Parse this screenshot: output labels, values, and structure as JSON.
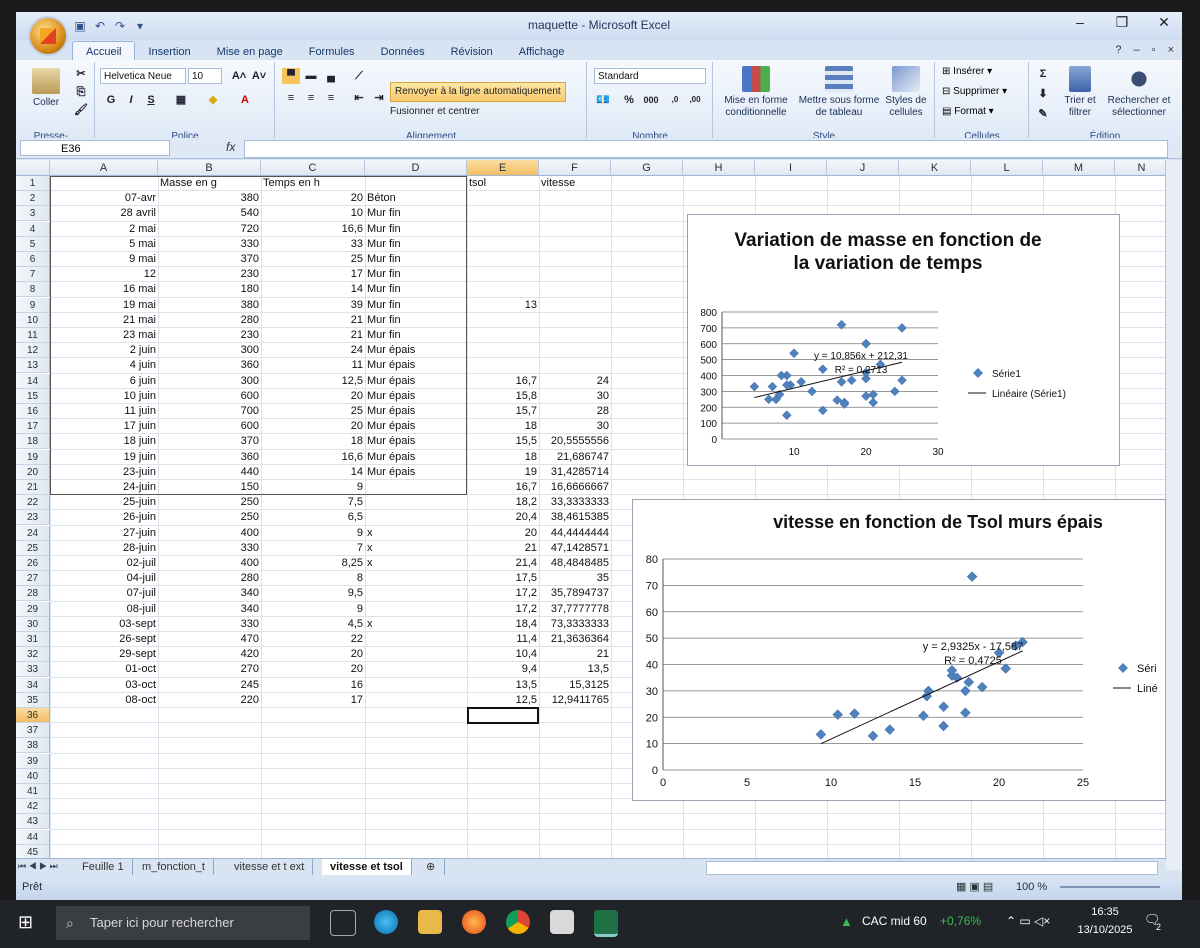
{
  "window": {
    "title": "maquette - Microsoft Excel"
  },
  "ribbon": {
    "tabs": [
      "Accueil",
      "Insertion",
      "Mise en page",
      "Formules",
      "Données",
      "Révision",
      "Affichage"
    ],
    "paste_label": "Coller",
    "font_name": "Helvetica Neue",
    "font_size": "10",
    "wrap_text": "Renvoyer à la ligne automatiquement",
    "merge_center": "Fusionner et centrer",
    "number_format": "Standard",
    "cond_format": "Mise en forme conditionnelle",
    "format_table": "Mettre sous forme de tableau",
    "cell_styles": "Styles de cellules",
    "insert": "Insérer",
    "delete": "Supprimer",
    "format": "Format",
    "sort_filter": "Trier et filtrer",
    "find_select": "Rechercher et sélectionner",
    "groups": {
      "clipboard": "Presse-...",
      "font": "Police",
      "alignment": "Alignement",
      "number": "Nombre",
      "style": "Style",
      "cells": "Cellules",
      "edit": "Édition"
    }
  },
  "formula_bar": {
    "name_box": "E36",
    "fx": "fx"
  },
  "columns": [
    "A",
    "B",
    "C",
    "D",
    "E",
    "F",
    "G",
    "H",
    "I",
    "J",
    "K",
    "L",
    "M",
    "N"
  ],
  "rows": [
    [
      "",
      "Masse en g",
      "Temps en h",
      "",
      "tsol",
      "vitesse"
    ],
    [
      "07-avr",
      "380",
      "20",
      "Béton",
      "",
      ""
    ],
    [
      "28 avril",
      "540",
      "10",
      "Mur fin",
      "",
      ""
    ],
    [
      "2 mai",
      "720",
      "16,6",
      "Mur fin",
      "",
      ""
    ],
    [
      "5 mai",
      "330",
      "33",
      "Mur fin",
      "",
      ""
    ],
    [
      "9 mai",
      "370",
      "25",
      "Mur fin",
      "",
      ""
    ],
    [
      "12",
      "230",
      "17",
      "Mur fin",
      "",
      ""
    ],
    [
      "16 mai",
      "180",
      "14",
      "Mur fin",
      "",
      ""
    ],
    [
      "19 mai",
      "380",
      "39",
      "Mur fin",
      "13",
      ""
    ],
    [
      "21 mai",
      "280",
      "21",
      "Mur fin",
      "",
      ""
    ],
    [
      "23 mai",
      "230",
      "21",
      "Mur fin",
      "",
      ""
    ],
    [
      "2 juin",
      "300",
      "24",
      "Mur épais",
      "",
      ""
    ],
    [
      "4 juin",
      "360",
      "11",
      "Mur épais",
      "",
      ""
    ],
    [
      "6 juin",
      "300",
      "12,5",
      "Mur épais",
      "16,7",
      "24"
    ],
    [
      "10 juin",
      "600",
      "20",
      "Mur épais",
      "15,8",
      "30"
    ],
    [
      "11 juin",
      "700",
      "25",
      "Mur épais",
      "15,7",
      "28"
    ],
    [
      "17 juin",
      "600",
      "20",
      "Mur épais",
      "18",
      "30"
    ],
    [
      "18 juin",
      "370",
      "18",
      "Mur épais",
      "15,5",
      "20,5555556"
    ],
    [
      "19 juin",
      "360",
      "16,6",
      "Mur épais",
      "18",
      "21,686747"
    ],
    [
      "23-juin",
      "440",
      "14",
      "Mur épais",
      "19",
      "31,4285714"
    ],
    [
      "24-juin",
      "150",
      "9",
      "",
      "16,7",
      "16,6666667"
    ],
    [
      "25-juin",
      "250",
      "7,5",
      "",
      "18,2",
      "33,3333333"
    ],
    [
      "26-juin",
      "250",
      "6,5",
      "",
      "20,4",
      "38,4615385"
    ],
    [
      "27-juin",
      "400",
      "9",
      "x",
      "20",
      "44,4444444"
    ],
    [
      "28-juin",
      "330",
      "7",
      "x",
      "21",
      "47,1428571"
    ],
    [
      "02-juil",
      "400",
      "8,25",
      "x",
      "21,4",
      "48,4848485"
    ],
    [
      "04-juil",
      "280",
      "8",
      "",
      "17,5",
      "35"
    ],
    [
      "07-juil",
      "340",
      "9,5",
      "",
      "17,2",
      "35,7894737"
    ],
    [
      "08-juil",
      "340",
      "9",
      "",
      "17,2",
      "37,7777778"
    ],
    [
      "03-sept",
      "330",
      "4,5",
      "x",
      "18,4",
      "73,3333333"
    ],
    [
      "26-sept",
      "470",
      "22",
      "",
      "11,4",
      "21,3636364"
    ],
    [
      "29-sept",
      "420",
      "20",
      "",
      "10,4",
      "21"
    ],
    [
      "01-oct",
      "270",
      "20",
      "",
      "9,4",
      "13,5"
    ],
    [
      "03-oct",
      "245",
      "16",
      "",
      "13,5",
      "15,3125"
    ],
    [
      "08-oct",
      "220",
      "17",
      "",
      "12,5",
      "12,9411765"
    ]
  ],
  "chart_data": [
    {
      "type": "scatter",
      "title": "Variation de masse en fonction de la variation de temps",
      "xlim": [
        0,
        30
      ],
      "ylim": [
        0,
        800
      ],
      "xticks": [
        "10",
        "20",
        "30"
      ],
      "yticks": [
        "0",
        "100",
        "200",
        "300",
        "400",
        "500",
        "600",
        "700",
        "800"
      ],
      "series": [
        {
          "name": "Série1",
          "points": [
            [
              20,
              380
            ],
            [
              10,
              540
            ],
            [
              16.6,
              720
            ],
            [
              33,
              330
            ],
            [
              25,
              370
            ],
            [
              17,
              230
            ],
            [
              14,
              180
            ],
            [
              39,
              380
            ],
            [
              21,
              280
            ],
            [
              21,
              230
            ],
            [
              24,
              300
            ],
            [
              11,
              360
            ],
            [
              12.5,
              300
            ],
            [
              20,
              600
            ],
            [
              25,
              700
            ],
            [
              20,
              600
            ],
            [
              18,
              370
            ],
            [
              16.6,
              360
            ],
            [
              14,
              440
            ],
            [
              9,
              150
            ],
            [
              7.5,
              250
            ],
            [
              6.5,
              250
            ],
            [
              9,
              400
            ],
            [
              7,
              330
            ],
            [
              8.25,
              400
            ],
            [
              8,
              280
            ],
            [
              9.5,
              340
            ],
            [
              9,
              340
            ],
            [
              4.5,
              330
            ],
            [
              22,
              470
            ],
            [
              20,
              420
            ],
            [
              20,
              270
            ],
            [
              16,
              245
            ],
            [
              17,
              220
            ]
          ]
        }
      ],
      "trendline": {
        "name": "Linéaire (Série1)",
        "slope": 10.856,
        "intercept": 212.31
      },
      "equation": "y = 10,856x + 212,31",
      "r2": "R² = 0,2713",
      "legend": [
        "Série1",
        "Linéaire (Série1)"
      ]
    },
    {
      "type": "scatter",
      "title": "vitesse en fonction de Tsol murs épais",
      "xlim": [
        0,
        25
      ],
      "ylim": [
        0,
        80
      ],
      "xticks": [
        "0",
        "5",
        "10",
        "15",
        "20",
        "25"
      ],
      "yticks": [
        "0",
        "10",
        "20",
        "30",
        "40",
        "50",
        "60",
        "70",
        "80"
      ],
      "series": [
        {
          "name": "Séri",
          "points": [
            [
              16.7,
              24
            ],
            [
              15.8,
              30
            ],
            [
              15.7,
              28
            ],
            [
              18,
              30
            ],
            [
              15.5,
              20.56
            ],
            [
              18,
              21.69
            ],
            [
              19,
              31.43
            ],
            [
              16.7,
              16.67
            ],
            [
              18.2,
              33.33
            ],
            [
              20.4,
              38.46
            ],
            [
              20,
              44.44
            ],
            [
              21,
              47.14
            ],
            [
              21.4,
              48.48
            ],
            [
              17.5,
              35
            ],
            [
              17.2,
              35.79
            ],
            [
              17.2,
              37.78
            ],
            [
              18.4,
              73.33
            ],
            [
              11.4,
              21.36
            ],
            [
              10.4,
              21
            ],
            [
              9.4,
              13.5
            ],
            [
              13.5,
              15.31
            ],
            [
              12.5,
              12.94
            ]
          ]
        }
      ],
      "trendline": {
        "name": "Liné",
        "slope": 2.9325,
        "intercept": -17.587
      },
      "equation": "y = 2,9325x - 17,587",
      "r2": "R² = 0,4725",
      "legend": [
        "Séri",
        "Liné"
      ]
    }
  ],
  "sheets": [
    "Feuille 1",
    "m_fonction_t",
    "vitesse et t ext",
    "vitesse et tsol"
  ],
  "status": {
    "ready": "Prêt",
    "zoom": "100 %"
  },
  "taskbar": {
    "search_placeholder": "Taper ici pour rechercher",
    "stock_name": "CAC mid 60",
    "stock_change": "+0,76%",
    "time": "16:35",
    "date": "13/10/2025",
    "notif_count": "2"
  }
}
